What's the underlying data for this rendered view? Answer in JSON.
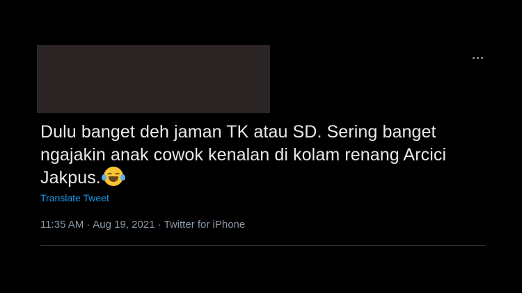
{
  "tweet": {
    "text_lines": [
      "Dulu banget deh jaman TK atau SD. Sering banget",
      "ngajakin anak cowok kenalan di kolam renang Arcici",
      "Jakpus."
    ],
    "emoji": "face-with-tears-of-joy-icon",
    "translate_label": "Translate Tweet",
    "time": "11:35 AM",
    "date": "Aug 19, 2021",
    "separator": "·",
    "source": "Twitter for iPhone",
    "more_icon": "more-horizontal-icon"
  },
  "colors": {
    "background": "#000000",
    "text": "#e7e9ea",
    "secondary": "#8b98a5",
    "link": "#1d9bf0",
    "redaction": "#2b2424",
    "divider": "#2f3336"
  }
}
